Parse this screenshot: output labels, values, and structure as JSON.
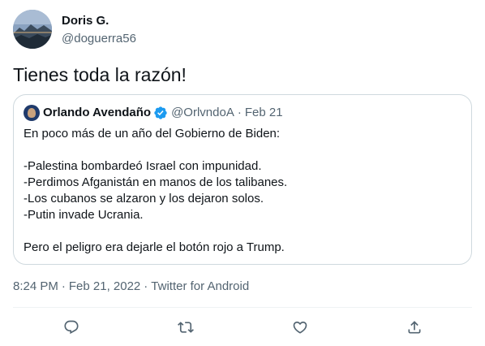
{
  "tweet": {
    "author": {
      "name": "Doris G.",
      "handle": "@doguerra56",
      "avatar_icon": "mountain-landscape-avatar"
    },
    "text": "Tienes toda la razón!",
    "quoted": {
      "author_name": "Orlando Avendaño",
      "verified": true,
      "handle": "@OrlvndoA",
      "date": "Feb 21",
      "lines": [
        "En poco más de un año del Gobierno de Biden:",
        "",
        "-Palestina bombardeó Israel con impunidad.",
        "-Perdimos Afganistán en manos de los talibanes.",
        "-Los cubanos se alzaron y los dejaron solos.",
        "-Putin invade Ucrania.",
        "",
        "Pero el peligro era dejarle el botón rojo a Trump."
      ]
    },
    "meta": {
      "time": "8:24 PM",
      "date": "Feb 21, 2022",
      "source": "Twitter for Android"
    },
    "actions": [
      "reply-icon",
      "retweet-icon",
      "like-icon",
      "share-icon"
    ]
  },
  "colors": {
    "text_primary": "#0f1419",
    "text_secondary": "#536471",
    "border": "#cfd9de",
    "verified_blue": "#1d9bf0"
  }
}
